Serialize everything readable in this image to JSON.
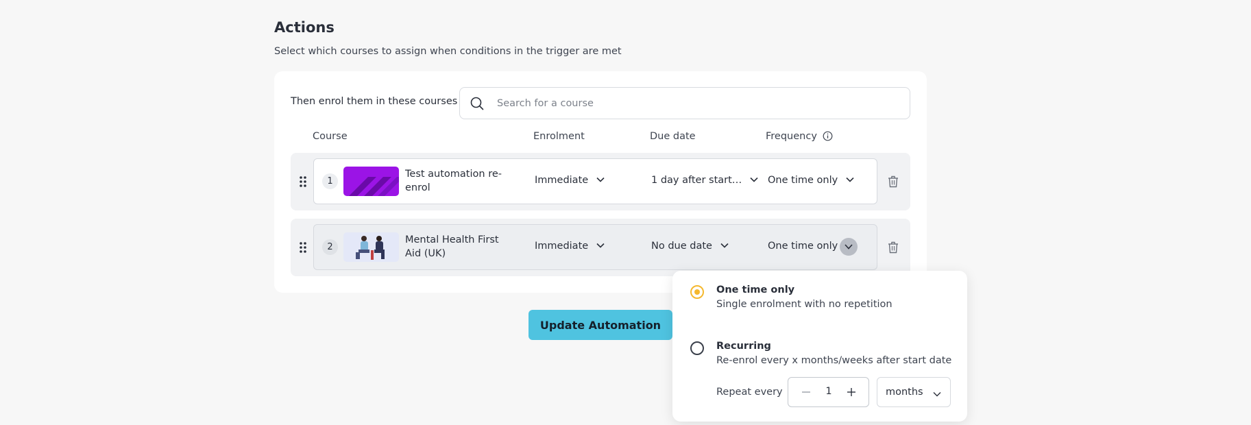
{
  "header": {
    "title": "Actions",
    "subtitle": "Select which courses to assign when conditions in the trigger are met"
  },
  "enrol": {
    "label": "Then enrol them in these courses",
    "search_placeholder": "Search for a course"
  },
  "columns": {
    "course": "Course",
    "enrolment": "Enrolment",
    "due_date": "Due date",
    "frequency": "Frequency"
  },
  "rows": [
    {
      "number": "1",
      "name": "Test automation re-enrol",
      "enrolment": "Immediate",
      "due_date": "1 day after start…",
      "frequency": "One time only"
    },
    {
      "number": "2",
      "name": "Mental Health First Aid (UK)",
      "enrolment": "Immediate",
      "due_date": "No due date",
      "frequency": "One time only"
    }
  ],
  "update_button": "Update Automation",
  "frequency_menu": {
    "options": [
      {
        "title": "One time only",
        "description": "Single enrolment with no repetition",
        "selected": true
      },
      {
        "title": "Recurring",
        "description": "Re-enrol every x months/weeks after start date",
        "selected": false
      }
    ],
    "repeat_label": "Repeat every",
    "repeat_value": "1",
    "repeat_unit": "months"
  },
  "colors": {
    "accent": "#f5b82e",
    "button": "#4fc3e0",
    "thumb_purple": "#9b14e6"
  },
  "icons": [
    "search-icon",
    "info-icon",
    "drag-handle-icon",
    "chevron-down-icon",
    "trash-icon",
    "minus-icon",
    "plus-icon"
  ]
}
